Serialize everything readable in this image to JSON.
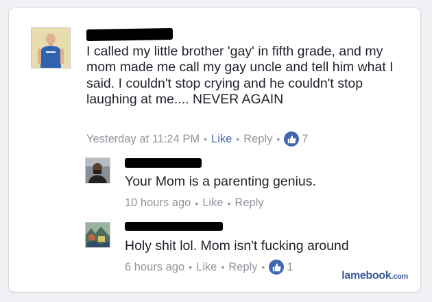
{
  "comment": {
    "author_name": "",
    "text": "I called my little brother 'gay' in fifth grade, and my mom made me call my gay uncle and tell him what I said. I couldn't stop crying and he couldn't stop laughing at me.... NEVER AGAIN",
    "timestamp": "Yesterday at 11:24 PM",
    "like_label": "Like",
    "reply_label": "Reply",
    "like_count": "7",
    "liked": true
  },
  "replies": [
    {
      "author_name": "",
      "text": "Your Mom is a parenting genius.",
      "timestamp": "10 hours ago",
      "like_label": "Like",
      "reply_label": "Reply"
    },
    {
      "author_name": "",
      "text": "Holy shit lol. Mom isn't fucking around",
      "timestamp": "6 hours ago",
      "like_label": "Like",
      "reply_label": "Reply",
      "like_count": "1"
    }
  ],
  "icons": {
    "like_badge": "thumbs-up-icon"
  },
  "colors": {
    "facebook_blue": "#4267b2",
    "meta_gray": "#90949c",
    "text": "#1d2129"
  },
  "watermark": {
    "brand": "lamebook",
    "suffix": ".com"
  }
}
